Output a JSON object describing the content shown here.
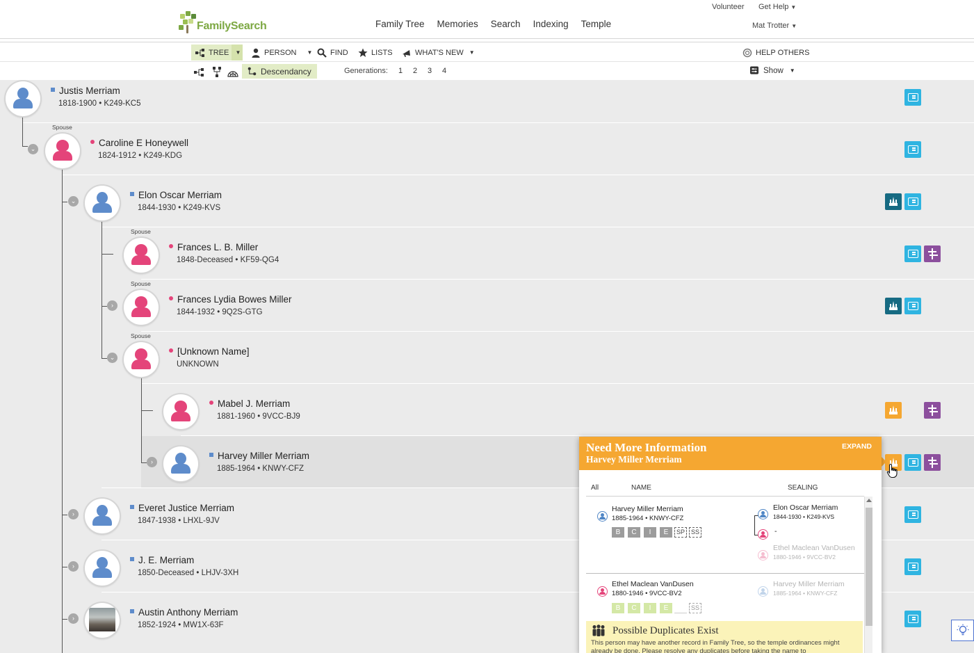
{
  "header": {
    "brand": "FamilySearch",
    "nav": [
      "Family Tree",
      "Memories",
      "Search",
      "Indexing",
      "Temple"
    ],
    "volunteer": "Volunteer",
    "get_help": "Get Help",
    "user": "Mat Trotter"
  },
  "toolbar": {
    "tree": "TREE",
    "person": "PERSON",
    "find": "FIND",
    "lists": "LISTS",
    "whats_new": "WHAT'S NEW",
    "help_others": "HELP OTHERS"
  },
  "viewbar": {
    "descendancy": "Descendancy",
    "generations_label": "Generations:",
    "generations": [
      "1",
      "2",
      "3",
      "4"
    ],
    "show": "Show"
  },
  "spouse_label": "Spouse",
  "people": [
    {
      "name": "Justis Merriam",
      "meta": "1818-1900 • K249-KC5",
      "sex": "male"
    },
    {
      "name": "Caroline E Honeywell",
      "meta": "1824-1912 • K249-KDG",
      "sex": "female"
    },
    {
      "name": "Elon Oscar Merriam",
      "meta": "1844-1930 • K249-KVS",
      "sex": "male"
    },
    {
      "name": "Frances L. B. Miller",
      "meta": "1848-Deceased • KF59-QG4",
      "sex": "female"
    },
    {
      "name": "Frances Lydia Bowes Miller",
      "meta": "1844-1932 • 9Q2S-GTG",
      "sex": "female"
    },
    {
      "name": "[Unknown Name]",
      "meta": "UNKNOWN",
      "sex": "female"
    },
    {
      "name": "Mabel J. Merriam",
      "meta": "1881-1960 • 9VCC-BJ9",
      "sex": "female"
    },
    {
      "name": "Harvey Miller Merriam",
      "meta": "1885-1964 • KNWY-CFZ",
      "sex": "male"
    },
    {
      "name": "Everet Justice Merriam",
      "meta": "1847-1938 • LHXL-9JV",
      "sex": "male"
    },
    {
      "name": "J. E. Merriam",
      "meta": "1850-Deceased • LHJV-3XH",
      "sex": "male"
    },
    {
      "name": "Austin Anthony Merriam",
      "meta": "1852-1924 • MW1X-63F",
      "sex": "male"
    }
  ],
  "popup": {
    "title": "Need More Information",
    "subtitle": "Harvey Miller Merriam",
    "expand": "EXPAND",
    "col_all": "All",
    "col_name": "NAME",
    "col_sealing": "SEALING",
    "record1": {
      "name": "Harvey Miller Merriam",
      "meta": "1885-1964 • KNWY-CFZ",
      "ordinances": [
        "B",
        "C",
        "I",
        "E",
        "SP",
        "SS"
      ]
    },
    "sealing1": {
      "father_name": "Elon Oscar Merriam",
      "father_meta": "1844-1930 • K249-KVS",
      "mother_name": "-",
      "alt_name": "Ethel Maclean VanDusen",
      "alt_meta": "1880-1946 • 9VCC-BV2"
    },
    "record2": {
      "name": "Ethel Maclean VanDusen",
      "meta": "1880-1946 • 9VCC-BV2",
      "ordinances": [
        "B",
        "C",
        "I",
        "E",
        "",
        "SS"
      ]
    },
    "sealing2": {
      "name": "Harvey Miller Merriam",
      "meta": "1885-1964 • KNWY-CFZ"
    },
    "duplicates_title": "Possible Duplicates Exist",
    "duplicates_text": "This person may have another record in Family Tree, so the temple ordinances might already be done. Please resolve any duplicates before taking the name to"
  },
  "colors": {
    "male": "#5e8ccb",
    "female": "#e4447a",
    "accent_green": "#7da843",
    "card_blue": "#2fb4e1",
    "temple_dark": "#166a82",
    "temple_orange": "#f5a731",
    "tree_purple": "#8c4f9d"
  }
}
